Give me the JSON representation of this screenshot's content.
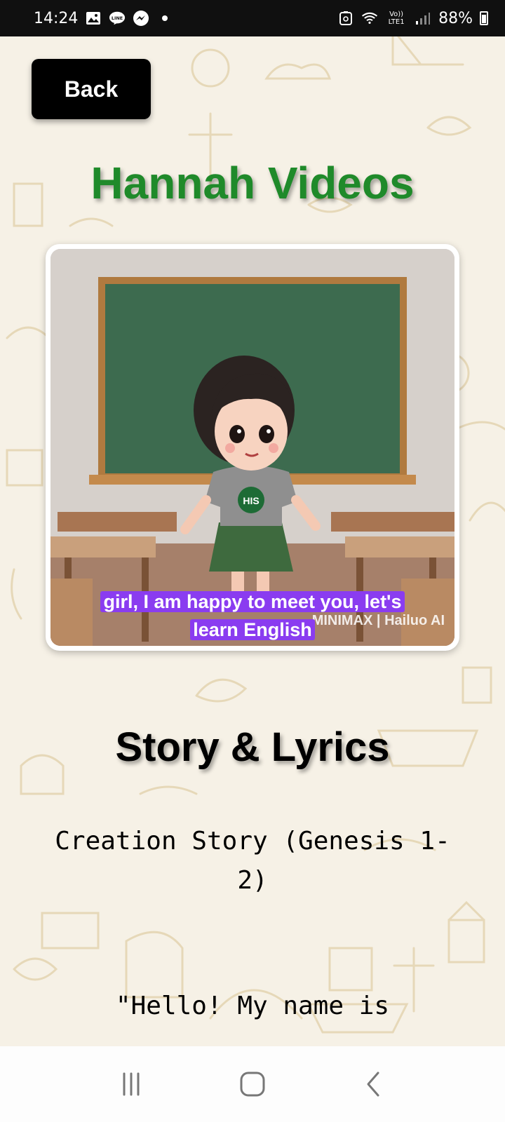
{
  "status_bar": {
    "time": "14:24",
    "left_icons": [
      "gallery-icon",
      "line-app-icon",
      "messenger-icon",
      "notification-dot-icon"
    ],
    "right_icons": [
      "data-saver-icon",
      "wifi-icon",
      "volte-lte-icon",
      "signal-icon"
    ],
    "volte_label": "Vo)) LTE1",
    "battery": "88%"
  },
  "header": {
    "back_label": "Back",
    "title": "Hannah Videos"
  },
  "video": {
    "caption_line1": "girl, I am happy to meet you, let's",
    "caption_line2": "learn English",
    "shirt_badge": "HIS",
    "watermark": "MINIMAX | Hailuo AI"
  },
  "story": {
    "heading": "Story & Lyrics",
    "title": "Creation Story  (Genesis 1-2)",
    "first_line": "\"Hello! My name is"
  },
  "nav": {
    "recents_icon": "recents-icon",
    "home_icon": "home-icon",
    "back_icon": "back-chevron-icon"
  },
  "colors": {
    "title_green": "#1f8a2a",
    "caption_purple": "#8a3cf0",
    "background": "#f6f1e6"
  }
}
